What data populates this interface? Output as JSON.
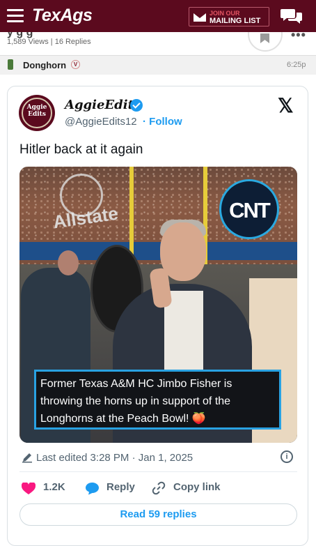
{
  "header": {
    "logo": "TexAgs",
    "mailing_small": "JOIN OUR",
    "mailing_big": "MAILING LIST"
  },
  "thread": {
    "title_fragment": "y  g  g",
    "stats": "1,589 Views | 16 Replies"
  },
  "post": {
    "username": "Donghorn",
    "badge": "V",
    "time": "6:25p"
  },
  "tweet": {
    "display_name": "AggieEdits",
    "handle": "@AggieEdits12",
    "follow": "· Follow",
    "avatar_text": "Aggie Edits",
    "text": "Hitler back at it again",
    "media": {
      "cnt_logo": "CNT",
      "allstate_text": "Allstate",
      "caption": "Former Texas A&M HC Jimbo Fisher is throwing the horns up in support of the Longhorns at the Peach Bowl! 🍑"
    },
    "edited": "Last edited 3:28 PM · Jan 1, 2025",
    "likes": "1.2K",
    "reply": "Reply",
    "copy_link": "Copy link",
    "read_replies": "Read 59 replies",
    "colors": {
      "accent": "#1d9bf0",
      "like": "#f91880",
      "brand": "#5b0a1e"
    }
  }
}
